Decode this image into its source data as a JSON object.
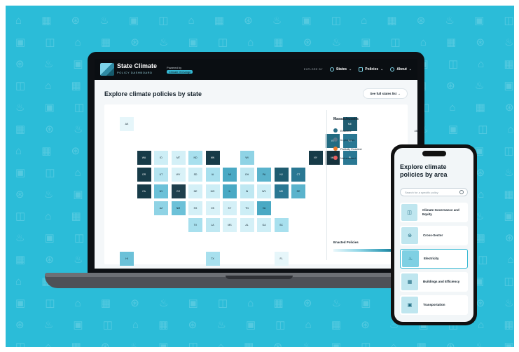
{
  "laptop": {
    "brand": {
      "name": "State Climate",
      "tagline": "POLICY DASHBOARD",
      "powered_by": "Powered by",
      "partner": "Climate XChange"
    },
    "nav": {
      "explore_by": "EXPLORE BY",
      "states": "States",
      "policies": "Policies",
      "about": "About"
    },
    "page_title": "Explore climate policies by state",
    "see_all": "See full states list",
    "side_panel": {
      "state": "Massachusetts",
      "legend": [
        {
          "label": "Enacted:",
          "count": "45",
          "color": "#2a6f86"
        },
        {
          "label": "In-progress",
          "count": "",
          "color": "#5b7a8c"
        },
        {
          "label": "Partially Enacted:",
          "count": "",
          "color": "#f07c2c"
        },
        {
          "label": "Not enacted:",
          "count": "",
          "color": "#e95f5f"
        }
      ],
      "enacted_policies": "Enacted Policies"
    },
    "tiles": [
      {
        "abbr": "AK",
        "shade": "#e6f6fa",
        "c": 0,
        "r": 0
      },
      {
        "abbr": "ME",
        "shade": "#1f5c70",
        "c": 13,
        "r": 0
      },
      {
        "abbr": "VT",
        "shade": "#236c82",
        "c": 12,
        "r": 1
      },
      {
        "abbr": "NH",
        "shade": "#2a7893",
        "c": 13,
        "r": 1
      },
      {
        "abbr": "WA",
        "shade": "#173b48",
        "c": 1,
        "r": 2
      },
      {
        "abbr": "ID",
        "shade": "#cdeef6",
        "c": 2,
        "r": 2
      },
      {
        "abbr": "MT",
        "shade": "#d4f0f7",
        "c": 3,
        "r": 2
      },
      {
        "abbr": "ND",
        "shade": "#a8e0ee",
        "c": 4,
        "r": 2
      },
      {
        "abbr": "MN",
        "shade": "#173b48",
        "c": 5,
        "r": 2
      },
      {
        "abbr": "WI",
        "shade": "#8fd3e5",
        "c": 7,
        "r": 2
      },
      {
        "abbr": "NY",
        "shade": "#173b48",
        "c": 11,
        "r": 2
      },
      {
        "abbr": "MA",
        "shade": "#15323d",
        "c": 12,
        "r": 2
      },
      {
        "abbr": "RI",
        "shade": "#2a7893",
        "c": 13,
        "r": 2
      },
      {
        "abbr": "OR",
        "shade": "#173b48",
        "c": 1,
        "r": 3
      },
      {
        "abbr": "UT",
        "shade": "#b4e4f0",
        "c": 2,
        "r": 3
      },
      {
        "abbr": "WY",
        "shade": "#d9f2f8",
        "c": 3,
        "r": 3
      },
      {
        "abbr": "SD",
        "shade": "#cdeef6",
        "c": 4,
        "r": 3
      },
      {
        "abbr": "IA",
        "shade": "#a8e0ee",
        "c": 5,
        "r": 3
      },
      {
        "abbr": "MI",
        "shade": "#4aa9c4",
        "c": 6,
        "r": 3
      },
      {
        "abbr": "OH",
        "shade": "#bfe8f2",
        "c": 7,
        "r": 3
      },
      {
        "abbr": "PA",
        "shade": "#5ab3cc",
        "c": 8,
        "r": 3
      },
      {
        "abbr": "NJ",
        "shade": "#1f5c70",
        "c": 9,
        "r": 3
      },
      {
        "abbr": "CT",
        "shade": "#2a7893",
        "c": 10,
        "r": 3
      },
      {
        "abbr": "CA",
        "shade": "#173b48",
        "c": 1,
        "r": 4
      },
      {
        "abbr": "NV",
        "shade": "#6cc1d8",
        "c": 2,
        "r": 4
      },
      {
        "abbr": "CO",
        "shade": "#1f3f4c",
        "c": 3,
        "r": 4
      },
      {
        "abbr": "NE",
        "shade": "#d4f0f7",
        "c": 4,
        "r": 4
      },
      {
        "abbr": "MO",
        "shade": "#cdeef6",
        "c": 5,
        "r": 4
      },
      {
        "abbr": "IL",
        "shade": "#4aa9c4",
        "c": 6,
        "r": 4
      },
      {
        "abbr": "IN",
        "shade": "#bfe8f2",
        "c": 7,
        "r": 4
      },
      {
        "abbr": "WV",
        "shade": "#cdeef6",
        "c": 8,
        "r": 4
      },
      {
        "abbr": "MD",
        "shade": "#2a7893",
        "c": 9,
        "r": 4
      },
      {
        "abbr": "DE",
        "shade": "#5ab3cc",
        "c": 10,
        "r": 4
      },
      {
        "abbr": "AZ",
        "shade": "#8fd3e5",
        "c": 2,
        "r": 5
      },
      {
        "abbr": "NM",
        "shade": "#6cc1d8",
        "c": 3,
        "r": 5
      },
      {
        "abbr": "KS",
        "shade": "#d4f0f7",
        "c": 4,
        "r": 5
      },
      {
        "abbr": "OK",
        "shade": "#d9f2f8",
        "c": 5,
        "r": 5
      },
      {
        "abbr": "KY",
        "shade": "#d4f0f7",
        "c": 6,
        "r": 5
      },
      {
        "abbr": "TN",
        "shade": "#cdeef6",
        "c": 7,
        "r": 5
      },
      {
        "abbr": "VA",
        "shade": "#4aa9c4",
        "c": 8,
        "r": 5
      },
      {
        "abbr": "TX",
        "shade": "#a8e0ee",
        "c": 4,
        "r": 6
      },
      {
        "abbr": "LA",
        "shade": "#bfe8f2",
        "c": 5,
        "r": 6
      },
      {
        "abbr": "MS",
        "shade": "#d9f2f8",
        "c": 6,
        "r": 6
      },
      {
        "abbr": "AL",
        "shade": "#d4f0f7",
        "c": 7,
        "r": 6
      },
      {
        "abbr": "GA",
        "shade": "#cdeef6",
        "c": 8,
        "r": 6
      },
      {
        "abbr": "SC",
        "shade": "#a8e0ee",
        "c": 9,
        "r": 6
      },
      {
        "abbr": "HI",
        "shade": "#6cc1d8",
        "c": 0,
        "r": 8
      },
      {
        "abbr": "TX",
        "shade": "#a8e0ee",
        "c": 5,
        "r": 8
      },
      {
        "abbr": "FL",
        "shade": "#e6f6fa",
        "c": 9,
        "r": 8
      }
    ]
  },
  "phone": {
    "title": "Explore climate policies by area",
    "search_placeholder": "Search for a specific policy",
    "areas": [
      {
        "label": "Climate Governance and Equity",
        "icon": "◫"
      },
      {
        "label": "Cross-Sector",
        "icon": "⊛"
      },
      {
        "label": "Electricity",
        "icon": "♨"
      },
      {
        "label": "Buildings and Efficiency",
        "icon": "▦"
      },
      {
        "label": "Transportation",
        "icon": "▣"
      }
    ]
  }
}
